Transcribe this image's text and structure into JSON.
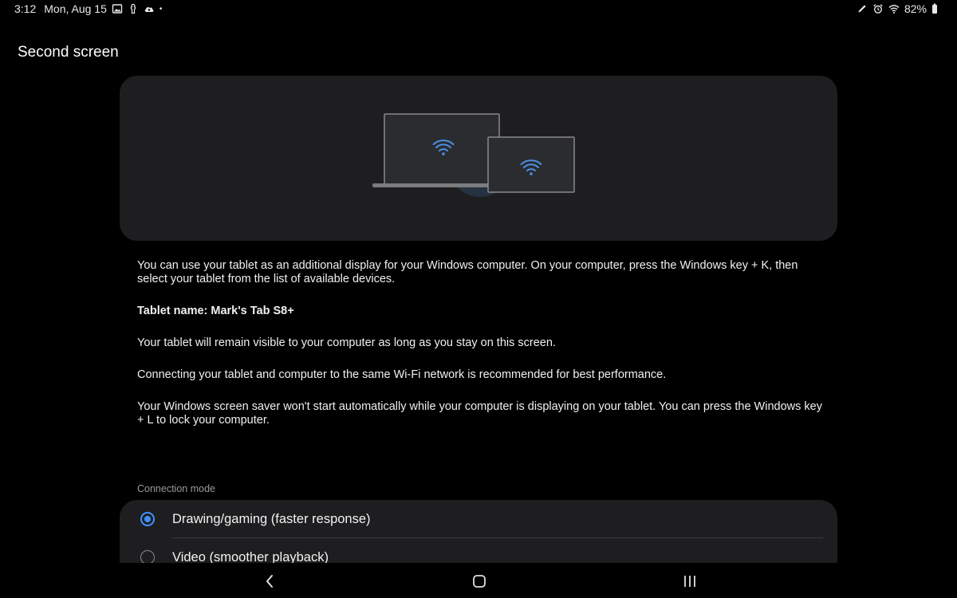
{
  "status_bar": {
    "time": "3:12",
    "date": "Mon, Aug 15",
    "left_icons": [
      "gallery-icon",
      "notification-icon",
      "cloud-upload-icon"
    ],
    "dot": "•",
    "right_icons": [
      "pen-icon",
      "alarm-icon",
      "wifi-icon"
    ],
    "battery": "82%"
  },
  "page": {
    "title": "Second screen"
  },
  "illustration": {
    "devices": [
      "laptop",
      "tablet"
    ],
    "accent_color": "#4a90e2"
  },
  "content": {
    "intro": "You can use your tablet as an additional display for your Windows computer. On your computer, press the Windows key + K, then select your tablet from the list of available devices.",
    "tablet_name": "Tablet name: Mark's Tab S8+",
    "visibility_note": "Your tablet will remain visible to your computer as long as you stay on this screen.",
    "wifi_note": "Connecting your tablet and computer to the same Wi-Fi network is recommended for best performance.",
    "screensaver_note": "Your Windows screen saver won't start automatically while your computer is displaying on your tablet. You can press the Windows key + L to lock your computer."
  },
  "connection_mode": {
    "label": "Connection mode",
    "options": [
      {
        "label": "Drawing/gaming (faster response)",
        "selected": true
      },
      {
        "label": "Video (smoother playback)",
        "selected": false
      }
    ],
    "selected_color": "#3e91ff"
  },
  "nav_bar": {
    "buttons": [
      "back-icon",
      "home-icon",
      "recent-apps-icon"
    ]
  }
}
